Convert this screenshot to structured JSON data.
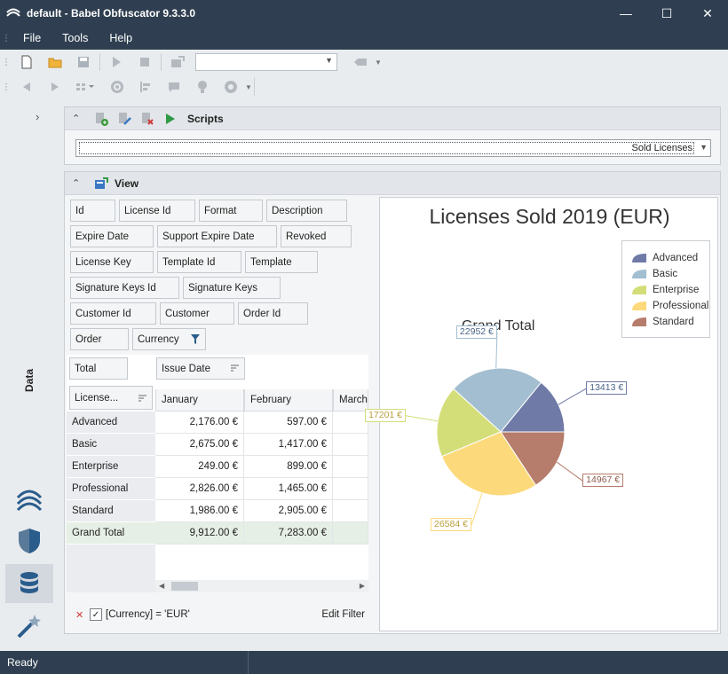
{
  "window": {
    "title": "default -  Babel Obfuscator 9.3.3.0",
    "minimize": "—",
    "maximize": "☐",
    "close": "✕"
  },
  "menu": {
    "file": "File",
    "tools": "Tools",
    "help": "Help"
  },
  "sidebar": {
    "data_label": "Data"
  },
  "scripts_panel": {
    "title": "Scripts",
    "selected_script": "Sold Licenses"
  },
  "view_panel": {
    "title": "View",
    "fields": {
      "id": "Id",
      "license_id": "License Id",
      "format": "Format",
      "description": "Description",
      "expire_date": "Expire Date",
      "support_expire_date": "Support Expire Date",
      "revoked": "Revoked",
      "license_key": "License Key",
      "template_id": "Template Id",
      "template": "Template",
      "signature_keys_id": "Signature Keys Id",
      "signature_keys": "Signature Keys",
      "customer_id": "Customer Id",
      "customer": "Customer",
      "order_id": "Order Id",
      "order": "Order",
      "currency": "Currency"
    },
    "data_field": "Total",
    "column_field": "Issue Date",
    "row_field": "License...",
    "columns": [
      "January",
      "February",
      "March"
    ],
    "rows": [
      {
        "label": "Advanced",
        "jan": "2,176.00 €",
        "feb": "597.00 €"
      },
      {
        "label": "Basic",
        "jan": "2,675.00 €",
        "feb": "1,417.00 €"
      },
      {
        "label": "Enterprise",
        "jan": "249.00 €",
        "feb": "899.00 €"
      },
      {
        "label": "Professional",
        "jan": "2,826.00 €",
        "feb": "1,465.00 €"
      },
      {
        "label": "Standard",
        "jan": "1,986.00 €",
        "feb": "2,905.00 €"
      },
      {
        "label": "Grand Total",
        "jan": "9,912.00 €",
        "feb": "7,283.00 €"
      }
    ],
    "filter_text": "[Currency] = 'EUR'",
    "edit_filter": "Edit Filter"
  },
  "status": {
    "text": "Ready"
  },
  "colors": {
    "Advanced": "#6f7aa6",
    "Basic": "#a3bed0",
    "Enterprise": "#d3de79",
    "Professional": "#fcd97a",
    "Standard": "#b67c6c"
  },
  "chart_data": {
    "type": "pie",
    "title": "Licenses Sold 2019 (EUR)",
    "subtitle": "Grand Total",
    "legend_position": "top-right",
    "categories": [
      "Advanced",
      "Basic",
      "Enterprise",
      "Professional",
      "Standard"
    ],
    "values": [
      13413,
      22952,
      17201,
      26584,
      14967
    ],
    "labels": [
      "13413 €",
      "22952 €",
      "17201 €",
      "26584 €",
      "14967 €"
    ]
  }
}
